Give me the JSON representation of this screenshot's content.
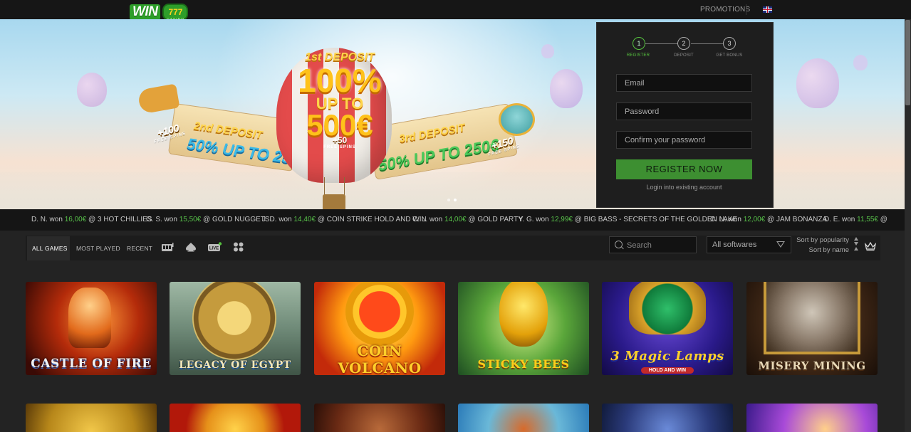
{
  "header": {
    "logo_text": "WIN",
    "logo_reels": "777",
    "logo_sub": "CASINO",
    "promotions": "PROMOTIONS",
    "language_icon": "uk-flag-icon"
  },
  "banner": {
    "deposit1_label": "1st DEPOSIT",
    "deposit1_percent": "100%",
    "deposit1_upto": "UP TO",
    "deposit1_amount": "500€",
    "deposit1_spins": "+50",
    "deposit1_spins_label": "FREE SPINS",
    "deposit2_label": "2nd DEPOSIT",
    "deposit2_offer": "50% UP TO 250€",
    "deposit2_spins": "+100",
    "deposit2_spins_label": "FREE SPINS",
    "deposit3_label": "3rd DEPOSIT",
    "deposit3_offer": "50% UP TO 250€",
    "deposit3_spins": "+150",
    "deposit3_spins_label": "FREE SPINS"
  },
  "register": {
    "steps": [
      {
        "num": "1",
        "label": "REGISTER"
      },
      {
        "num": "2",
        "label": "DEPOSIT"
      },
      {
        "num": "3",
        "label": "GET BONUS"
      }
    ],
    "email_placeholder": "Email",
    "password_placeholder": "Password",
    "confirm_placeholder": "Confirm your password",
    "register_button": "REGISTER NOW",
    "login_link": "Login into existing account"
  },
  "ticker": [
    {
      "name": "D. N. won ",
      "amount": "16,00€",
      "game": " @ 3 HOT CHILLIES"
    },
    {
      "name": "G. S. won ",
      "amount": "15,50€",
      "game": " @ GOLD NUGGETS"
    },
    {
      "name": "J. D. won ",
      "amount": "14,40€",
      "game": " @ COIN STRIKE HOLD AND WIN"
    },
    {
      "name": "C. L. won ",
      "amount": "14,00€",
      "game": " @ GOLD PARTY"
    },
    {
      "name": "Y. G. won ",
      "amount": "12,99€",
      "game": " @ BIG BASS - SECRETS OF THE GOLDEN LAKE"
    },
    {
      "name": "C. N. won ",
      "amount": "12,00€",
      "game": " @ JAM BONANZA"
    },
    {
      "name": "D. E. won ",
      "amount": "11,55€",
      "game": " @"
    }
  ],
  "filters": {
    "tabs": [
      "ALL GAMES",
      "MOST PLAYED",
      "RECENT"
    ],
    "search_placeholder": "Search",
    "software_select": "All softwares",
    "sort_popularity": "Sort by popularity",
    "sort_name": "Sort by name"
  },
  "games_row1": [
    {
      "title": "CASTLE OF FIRE"
    },
    {
      "title": "LEGACY OF EGYPT"
    },
    {
      "title": "COIN VOLCANO"
    },
    {
      "title": "STICKY BEES"
    },
    {
      "title": "3 Magic Lamps"
    },
    {
      "title": "MISERY MINING"
    }
  ],
  "games_row1_sub": {
    "magic_lamps_sub": "HOLD AND WIN"
  }
}
